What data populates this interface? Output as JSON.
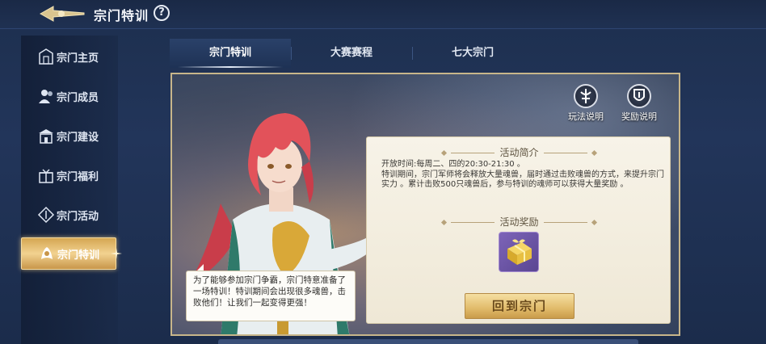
{
  "header": {
    "title": "宗门特训",
    "help_label": "?",
    "back_icon": "back-arrow-icon"
  },
  "sidebar": {
    "items": [
      {
        "label": "宗门主页",
        "icon": "sect-home-icon",
        "active": false
      },
      {
        "label": "宗门成员",
        "icon": "members-icon",
        "active": false
      },
      {
        "label": "宗门建设",
        "icon": "building-icon",
        "active": false
      },
      {
        "label": "宗门福利",
        "icon": "welfare-icon",
        "active": false
      },
      {
        "label": "宗门活动",
        "icon": "activity-icon",
        "active": false
      },
      {
        "label": "宗门特训",
        "icon": "training-icon",
        "active": true
      }
    ]
  },
  "tabs": [
    {
      "label": "宗门特训",
      "active": true
    },
    {
      "label": "大赛赛程",
      "active": false
    },
    {
      "label": "七大宗门",
      "active": false
    }
  ],
  "panel": {
    "buttons": [
      {
        "label": "玩法说明",
        "icon": "gameplay-info-icon"
      },
      {
        "label": "奖励说明",
        "icon": "reward-info-icon"
      }
    ],
    "intro_title": "活动简介",
    "intro_time": "开放时间:每周二、四的20:30-21:30 。",
    "intro_desc": "特训期间，宗门军师将会释放大量魂兽，届时通过击败魂兽的方式，来提升宗门实力 。累计击败500只魂兽后，参与特训的魂师可以获得大量奖励 。",
    "reward_title": "活动奖励",
    "reward_icon": "gift-box-icon",
    "return_label": "回到宗门",
    "bubble_text": "为了能够参加宗门争霸，宗门特意准备了一场特训！特训期间会出现很多魂兽，击败他们！让我们一起变得更强！"
  },
  "colors": {
    "background": "#1f3152",
    "accent_gold": "#e1bb6a",
    "card_bg": "#f7f3e8",
    "reward_purple": "#7d64b8"
  }
}
